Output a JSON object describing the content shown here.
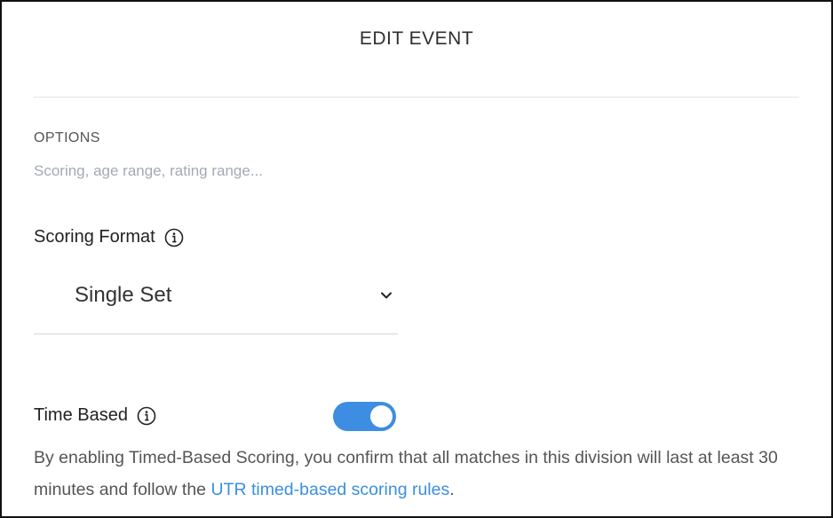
{
  "header": {
    "title": "EDIT EVENT"
  },
  "options": {
    "heading": "OPTIONS",
    "subtitle": "Scoring, age range, rating range..."
  },
  "scoring": {
    "label": "Scoring Format",
    "info_icon": "info-circle-icon",
    "selected_value": "Single Set",
    "dropdown_icon": "chevron-down-icon"
  },
  "time_based": {
    "label": "Time Based",
    "info_icon": "info-circle-icon",
    "toggle_on": true,
    "toggle_color": "#3d8de3",
    "description_prefix": "By enabling Timed-Based Scoring, you confirm that all matches in this division will last at least 30 minutes and follow the",
    "link_text": "UTR timed-based scoring rules",
    "description_suffix": "."
  },
  "colors": {
    "link": "#3a8fe0",
    "muted_text": "#a3aab3"
  }
}
